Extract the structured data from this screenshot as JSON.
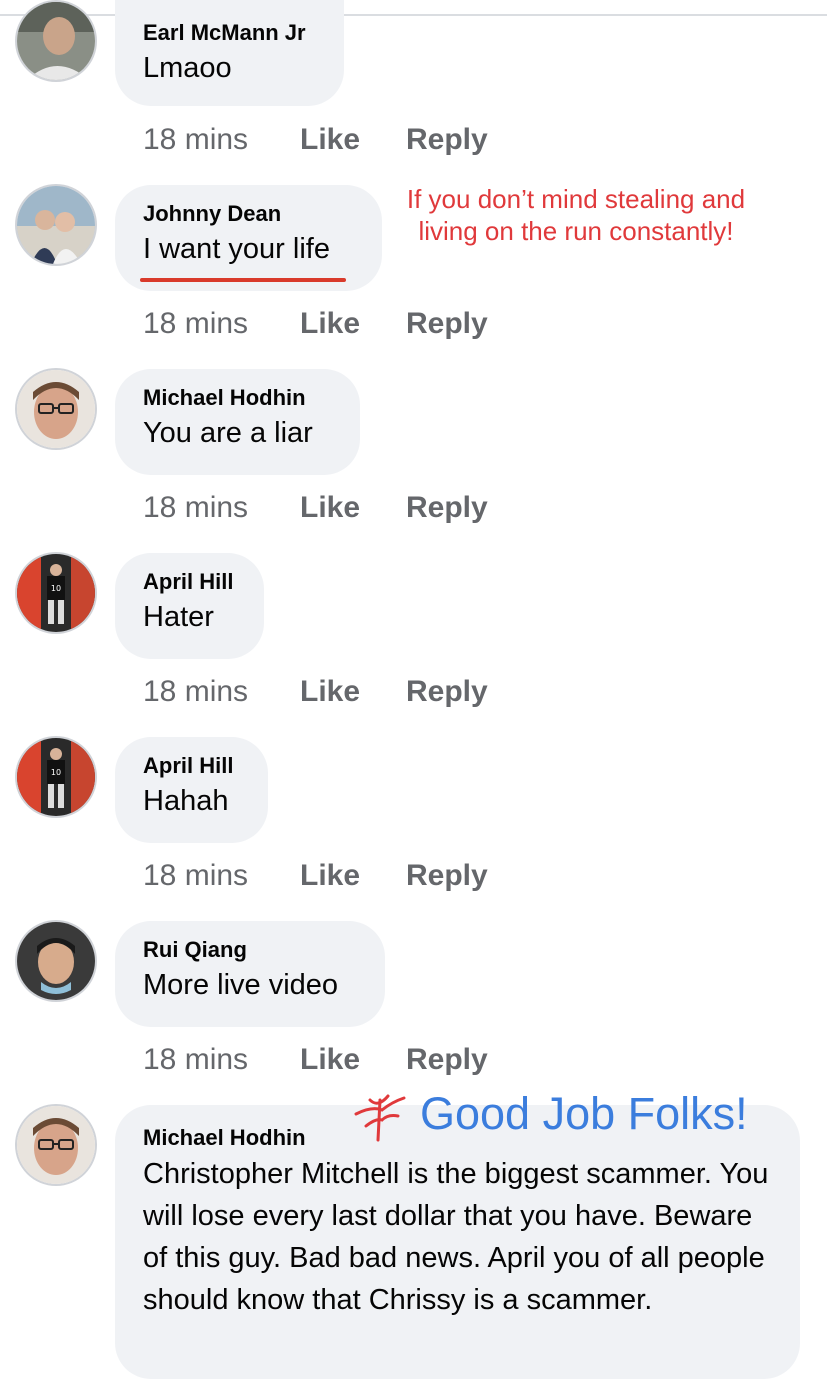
{
  "comments": [
    {
      "author": "Earl McMann Jr",
      "text": "Lmaoo",
      "time": "18 mins",
      "like": "Like",
      "reply": "Reply"
    },
    {
      "author": "Johnny Dean",
      "text": "I want your life",
      "time": "18 mins",
      "like": "Like",
      "reply": "Reply"
    },
    {
      "author": "Michael Hodhin",
      "text": "You are a liar",
      "time": "18 mins",
      "like": "Like",
      "reply": "Reply"
    },
    {
      "author": "April Hill",
      "text": "Hater",
      "time": "18 mins",
      "like": "Like",
      "reply": "Reply"
    },
    {
      "author": "April Hill",
      "text": "Hahah",
      "time": "18 mins",
      "like": "Like",
      "reply": "Reply"
    },
    {
      "author": "Rui Qiang",
      "text": "More live video",
      "time": "18 mins",
      "like": "Like",
      "reply": "Reply"
    },
    {
      "author": "Michael Hodhin",
      "text": "Christopher Mitchell is the biggest scammer. You will lose every last dollar that you have. Beware of this guy. Bad bad news. April you of all people should know that Chrissy is a scammer."
    }
  ],
  "annotations": {
    "red_note": "If you don’t mind stealing and living on the run constantly!",
    "blue_note": "Good Job Folks!"
  },
  "colors": {
    "bubble": "#f0f2f5",
    "meta_text": "#65676b",
    "annotation_red": "#e0393b",
    "annotation_blue": "#3b7ddd"
  }
}
